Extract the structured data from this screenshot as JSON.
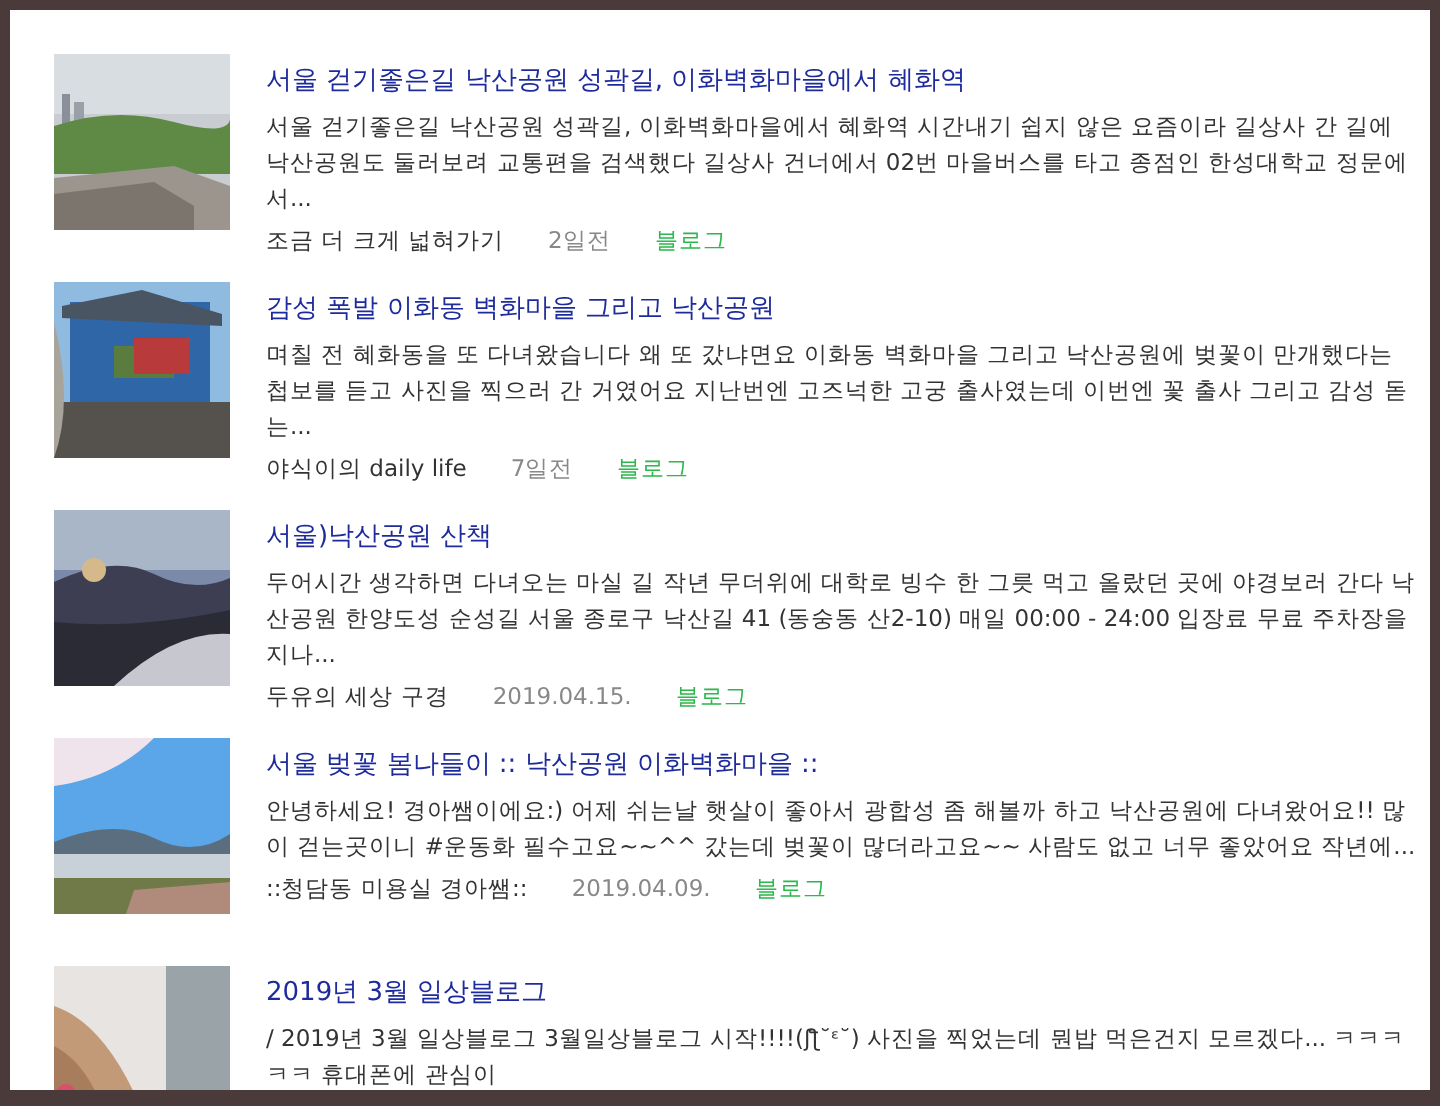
{
  "results": [
    {
      "title": "서울 걷기좋은길 낙산공원 성곽길, 이화벽화마을에서 혜화역",
      "description": "서울 걷기좋은길 낙산공원 성곽길, 이화벽화마을에서 혜화역 시간내기 쉽지 않은 요즘이라 길상사 간 길에 낙산공원도 둘러보려 교통편을 검색했다 길상사 건너에서 02번 마을버스를 타고 종점인 한성대학교 정문에서...",
      "author": "조금 더 크게 넓혀가기",
      "date": "2일전",
      "source": "블로그"
    },
    {
      "title": "감성 폭발 이화동 벽화마을 그리고 낙산공원",
      "description": "며칠 전 혜화동을 또 다녀왔습니다 왜 또 갔냐면요 이화동 벽화마을 그리고 낙산공원에 벚꽃이 만개했다는 첩보를 듣고 사진을 찍으러 간 거였어요 지난번엔 고즈넉한 고궁 출사였는데 이번엔 꽃 출사 그리고 감성 돋는...",
      "author": "야식이의 daily life",
      "date": "7일전",
      "source": "블로그"
    },
    {
      "title": "서울)낙산공원 산책",
      "description": "두어시간 생각하면 다녀오는 마실 길 작년 무더위에 대학로 빙수 한 그릇 먹고 올랐던 곳에 야경보러 간다 낙산공원 한양도성 순성길 서울 종로구 낙산길 41 (동숭동 산2-10) 매일 00:00 - 24:00 입장료 무료 주차장을 지나...",
      "author": "두유의 세상 구경",
      "date": "2019.04.15.",
      "source": "블로그"
    },
    {
      "title": "서울 벚꽃 봄나들이 :: 낙산공원 이화벽화마을 ::",
      "description": "안녕하세요! 경아쌤이에요:) 어제 쉬는날 햇살이 좋아서 광합성 좀 해볼까 하고 낙산공원에 다녀왔어요!! 많이 걷는곳이니 #운동화 필수고요~~^^ 갔는데 벚꽃이 많더라고요~~ 사람도 없고 너무 좋았어요 작년에...",
      "author": "::청담동 미용실 경아쌤::",
      "date": "2019.04.09.",
      "source": "블로그"
    },
    {
      "title": "2019년 3월 일상블로그",
      "description": "/ 2019년 3월 일상블로그 3월일상블로그 시작!!!!(ʃƪ˘ᵋ˘) 사진을 찍었는데 뭔밥 먹은건지 모르겠다... ㅋㅋㅋㅋㅋ 휴대폰에 관심이"
    }
  ]
}
